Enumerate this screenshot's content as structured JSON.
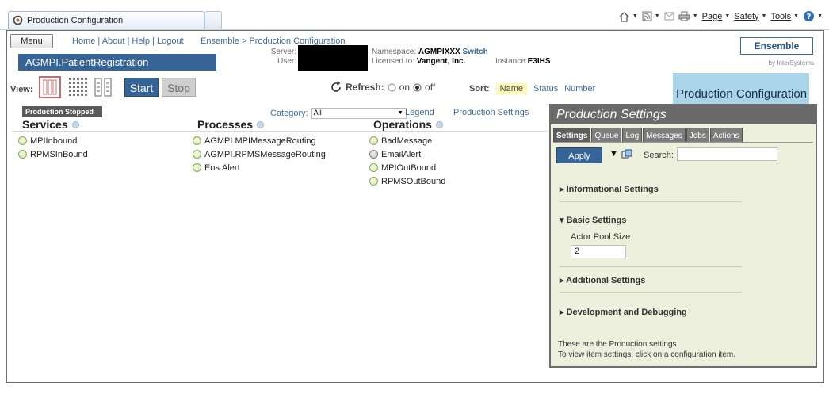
{
  "browser": {
    "tab_title": "Production Configuration",
    "commands": {
      "page": "Page",
      "safety": "Safety",
      "tools": "Tools"
    }
  },
  "header": {
    "menu_label": "Menu",
    "top_links": "Home | About | Help | Logout",
    "breadcrumb": "Ensemble > Production Configuration",
    "production_name": "AGMPI.PatientRegistration",
    "server_label": "Server:",
    "user_label": "User:",
    "namespace_label": "Namespace:",
    "namespace_value": "AGMPIXXX",
    "switch_link": "Switch",
    "licensed_label": "Licensed to:",
    "licensed_value": "Vangent, Inc.",
    "instance_label": "Instance:",
    "instance_value": "E3IHS",
    "logo": "Ensemble",
    "logo_by": "by InterSystems"
  },
  "toolbar": {
    "view_label": "View:",
    "start_label": "Start",
    "stop_label": "Stop",
    "refresh_label": "Refresh:",
    "refresh_on": "on",
    "refresh_off": "off",
    "sort_label": "Sort:",
    "sort_name": "Name",
    "sort_status": "Status",
    "sort_number": "Number",
    "page_header": "Production Configuration"
  },
  "status_badge": "Production Stopped",
  "filters": {
    "category_label": "Category:",
    "category_value": "All",
    "legend_link": "Legend",
    "production_settings_link": "Production Settings"
  },
  "columns": {
    "services": {
      "title": "Services",
      "items": [
        "MPIInbound",
        "RPMSInBound"
      ]
    },
    "processes": {
      "title": "Processes",
      "items": [
        "AGMPI.MPIMessageRouting",
        "AGMPI.RPMSMessageRouting",
        "Ens.Alert"
      ]
    },
    "operations": {
      "title": "Operations",
      "items": [
        "BadMessage",
        "EmailAlert",
        "MPIOutBound",
        "RPMSOutBound"
      ]
    }
  },
  "settings_panel": {
    "title": "Production Settings",
    "tabs": [
      "Settings",
      "Queue",
      "Log",
      "Messages",
      "Jobs",
      "Actions"
    ],
    "apply_label": "Apply",
    "search_label": "Search:",
    "sections": {
      "informational": "Informational Settings",
      "basic": "Basic Settings",
      "additional": "Additional Settings",
      "development": "Development and Debugging"
    },
    "actor_pool_label": "Actor Pool Size",
    "actor_pool_value": "2",
    "note_line1": "These are the Production settings.",
    "note_line2": "To view item settings, click on a configuration item."
  }
}
